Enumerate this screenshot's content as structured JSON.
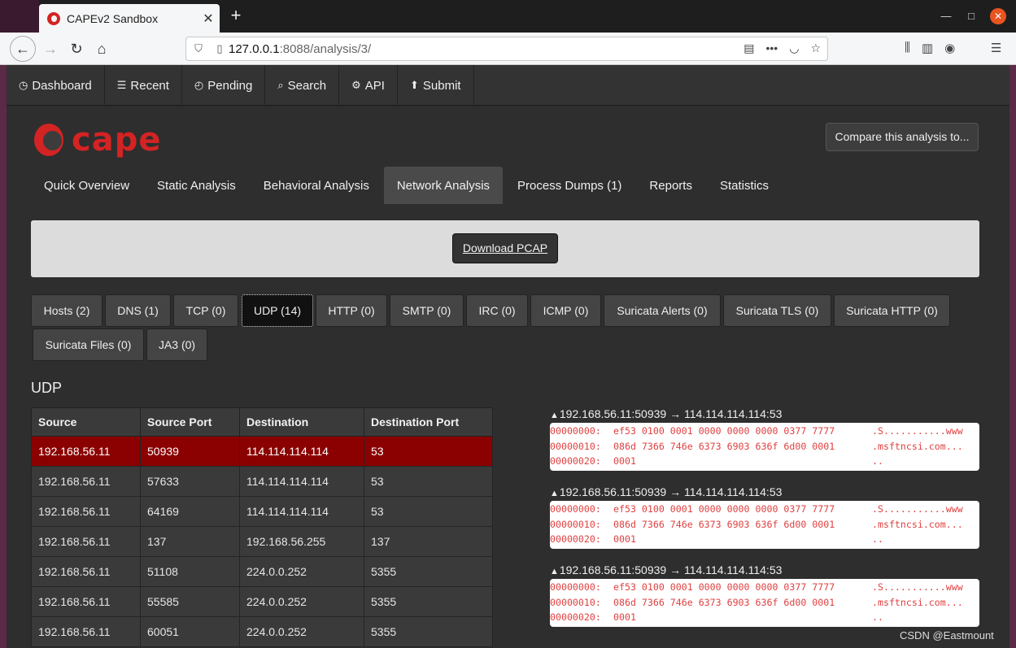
{
  "browser": {
    "tab_title": "CAPEv2 Sandbox",
    "url_host": "127.0.0.1",
    "url_rest": ":8088/analysis/3/",
    "icons": [
      "back-icon",
      "forward-icon",
      "reload-icon",
      "home-icon",
      "shield-icon",
      "page-icon",
      "reader-icon",
      "more-icon",
      "pocket-icon",
      "bookmark-star-icon",
      "library-icon",
      "sidebar-icon",
      "account-icon",
      "menu-icon"
    ]
  },
  "topnav": [
    {
      "icon": "dashboard-icon",
      "glyph": "◷",
      "label": "Dashboard"
    },
    {
      "icon": "list-icon",
      "glyph": "☰",
      "label": "Recent"
    },
    {
      "icon": "clock-icon",
      "glyph": "◴",
      "label": "Pending"
    },
    {
      "icon": "search-icon",
      "glyph": "⌕",
      "label": "Search"
    },
    {
      "icon": "gear-icon",
      "glyph": "⚙",
      "label": "API"
    },
    {
      "icon": "upload-icon",
      "glyph": "⬆",
      "label": "Submit"
    }
  ],
  "logo_text": "cape",
  "compare_label": "Compare this analysis to...",
  "subtabs": [
    "Quick Overview",
    "Static Analysis",
    "Behavioral Analysis",
    "Network Analysis",
    "Process Dumps (1)",
    "Reports",
    "Statistics"
  ],
  "active_subtab": "Network Analysis",
  "download_pcap_label": "Download PCAP",
  "pills": [
    "Hosts (2)",
    "DNS (1)",
    "TCP (0)",
    "UDP (14)",
    "HTTP (0)",
    "SMTP (0)",
    "IRC (0)",
    "ICMP (0)",
    "Suricata Alerts (0)",
    "Suricata TLS (0)",
    "Suricata HTTP (0)",
    "Suricata Files (0)",
    "JA3 (0)"
  ],
  "active_pill": "UDP (14)",
  "section_title": "UDP",
  "table": {
    "headers": [
      "Source",
      "Source Port",
      "Destination",
      "Destination Port"
    ],
    "rows": [
      [
        "192.168.56.11",
        "50939",
        "114.114.114.114",
        "53"
      ],
      [
        "192.168.56.11",
        "57633",
        "114.114.114.114",
        "53"
      ],
      [
        "192.168.56.11",
        "64169",
        "114.114.114.114",
        "53"
      ],
      [
        "192.168.56.11",
        "137",
        "192.168.56.255",
        "137"
      ],
      [
        "192.168.56.11",
        "51108",
        "224.0.0.252",
        "5355"
      ],
      [
        "192.168.56.11",
        "55585",
        "224.0.0.252",
        "5355"
      ],
      [
        "192.168.56.11",
        "60051",
        "224.0.0.252",
        "5355"
      ]
    ],
    "selected_row": 0
  },
  "streams": [
    {
      "header": "192.168.56.11:50939 → 114.114.114.114:53",
      "lines": [
        {
          "off": "00000000:",
          "bytes": "ef53 0100 0001 0000 0000 0000 0377 7777",
          "ascii": ".S...........www"
        },
        {
          "off": "00000010:",
          "bytes": "086d 7366 746e 6373 6903 636f 6d00 0001",
          "ascii": ".msftncsi.com..."
        },
        {
          "off": "00000020:",
          "bytes": "0001",
          "ascii": ".."
        }
      ]
    },
    {
      "header": "192.168.56.11:50939 → 114.114.114.114:53",
      "lines": [
        {
          "off": "00000000:",
          "bytes": "ef53 0100 0001 0000 0000 0000 0377 7777",
          "ascii": ".S...........www"
        },
        {
          "off": "00000010:",
          "bytes": "086d 7366 746e 6373 6903 636f 6d00 0001",
          "ascii": ".msftncsi.com..."
        },
        {
          "off": "00000020:",
          "bytes": "0001",
          "ascii": ".."
        }
      ]
    },
    {
      "header": "192.168.56.11:50939 → 114.114.114.114:53",
      "lines": [
        {
          "off": "00000000:",
          "bytes": "ef53 0100 0001 0000 0000 0000 0377 7777",
          "ascii": ".S...........www"
        },
        {
          "off": "00000010:",
          "bytes": "086d 7366 746e 6373 6903 636f 6d00 0001",
          "ascii": ".msftncsi.com..."
        },
        {
          "off": "00000020:",
          "bytes": "0001",
          "ascii": ".."
        }
      ]
    }
  ],
  "watermark": "CSDN @Eastmount",
  "colors": {
    "accent": "#d42323",
    "selected_row": "#8b0000",
    "hex_text": "#e04040",
    "window_close": "#e95420"
  }
}
